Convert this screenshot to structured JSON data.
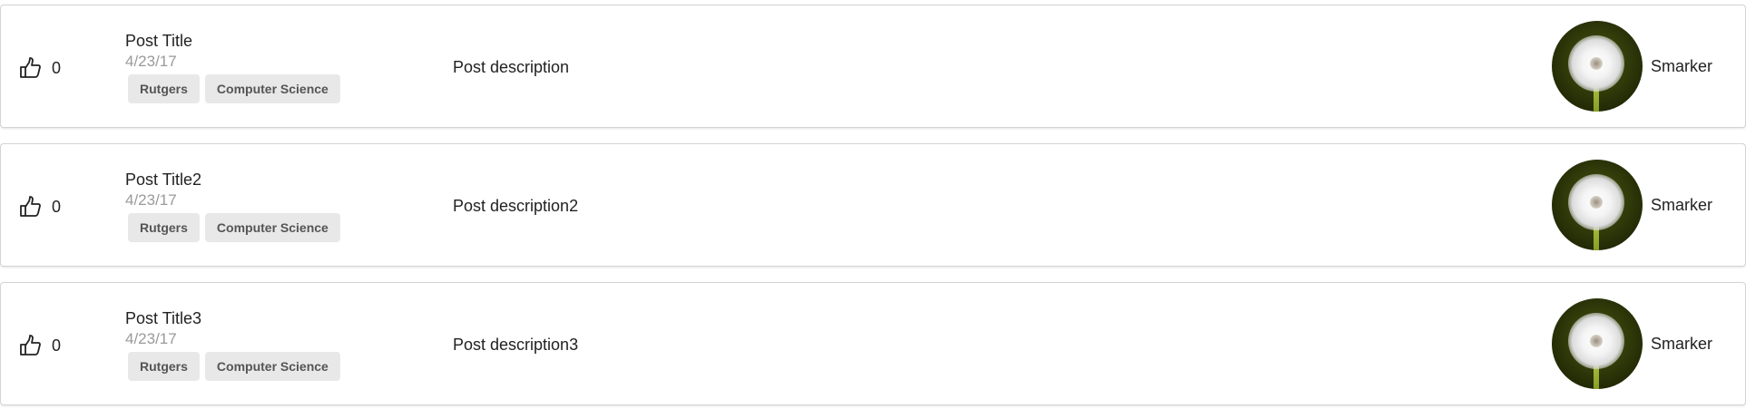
{
  "posts": [
    {
      "likes": "0",
      "title": "Post Title",
      "date": "4/23/17",
      "tags": [
        "Rutgers",
        "Computer Science"
      ],
      "description": "Post description",
      "author": "Smarker"
    },
    {
      "likes": "0",
      "title": "Post Title2",
      "date": "4/23/17",
      "tags": [
        "Rutgers",
        "Computer Science"
      ],
      "description": "Post description2",
      "author": "Smarker"
    },
    {
      "likes": "0",
      "title": "Post Title3",
      "date": "4/23/17",
      "tags": [
        "Rutgers",
        "Computer Science"
      ],
      "description": "Post description3",
      "author": "Smarker"
    }
  ],
  "icons": {
    "like": "thumbs-up-outline-icon"
  }
}
